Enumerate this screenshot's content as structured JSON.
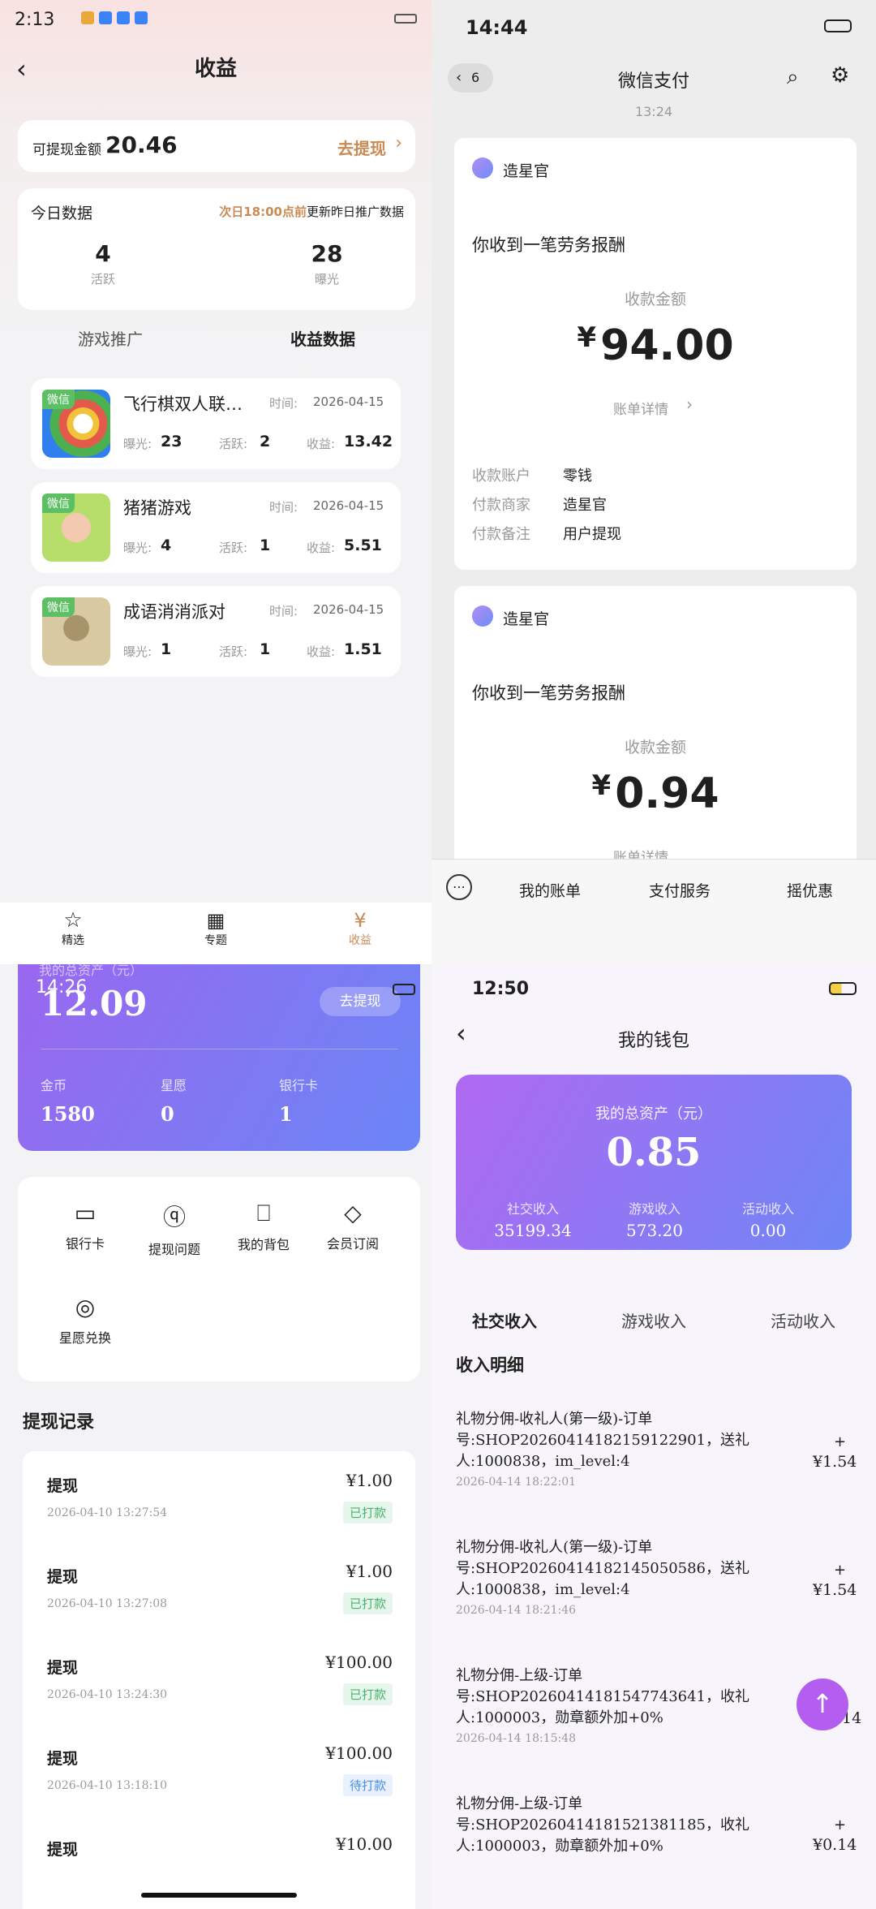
{
  "q1": {
    "status_time": "2:13",
    "title": "收益",
    "balance_label": "可提现金额",
    "balance_value": "20.46",
    "withdraw_link": "去提现",
    "today_title": "今日数据",
    "today_note_highlight": "次日18:00点前",
    "today_note_rest": "更新昨日推广数据",
    "stat_active_value": "4",
    "stat_active_label": "活跃",
    "stat_exposure_value": "28",
    "stat_exposure_label": "曝光",
    "tab_promo": "游戏推广",
    "tab_income": "收益数据",
    "games": [
      {
        "tag": "微信",
        "name": "飞行棋双人联…",
        "time_label": "时间:",
        "time": "2026-04-15",
        "exp_label": "曝光:",
        "exp": "23",
        "act_label": "活跃:",
        "act": "2",
        "inc_label": "收益:",
        "inc": "13.42"
      },
      {
        "tag": "微信",
        "name": "猪猪游戏",
        "time_label": "时间:",
        "time": "2026-04-15",
        "exp_label": "曝光:",
        "exp": "4",
        "act_label": "活跃:",
        "act": "1",
        "inc_label": "收益:",
        "inc": "5.51"
      },
      {
        "tag": "微信",
        "name": "成语消消派对",
        "time_label": "时间:",
        "time": "2026-04-15",
        "exp_label": "曝光:",
        "exp": "1",
        "act_label": "活跃:",
        "act": "1",
        "inc_label": "收益:",
        "inc": "1.51"
      }
    ],
    "nav": [
      {
        "label": "精选"
      },
      {
        "label": "专题"
      },
      {
        "label": "收益"
      }
    ],
    "accent": "#c98a55"
  },
  "q2": {
    "status_time": "14:44",
    "back_count": "6",
    "title": "微信支付",
    "timestamp": "13:24",
    "msgs": [
      {
        "sender": "造星官",
        "headline": "你收到一笔劳务报酬",
        "amount_label": "收款金额",
        "currency": "¥",
        "amount": "94.00",
        "detail": "账单详情",
        "rows": [
          {
            "k": "收款账户",
            "v": "零钱"
          },
          {
            "k": "付款商家",
            "v": "造星官"
          },
          {
            "k": "付款备注",
            "v": "用户提现"
          }
        ]
      },
      {
        "sender": "造星官",
        "headline": "你收到一笔劳务报酬",
        "amount_label": "收款金额",
        "currency": "¥",
        "amount": "0.94",
        "detail": "账单详情",
        "rows": []
      }
    ],
    "menu": [
      "我的账单",
      "支付服务",
      "摇优惠"
    ]
  },
  "q3": {
    "status_time": "14:26",
    "overlay_label": "我的总资产（元）",
    "total": "12.09",
    "withdraw_btn": "去提现",
    "assets": [
      {
        "label": "金币",
        "value": "1580"
      },
      {
        "label": "星愿",
        "value": "0"
      },
      {
        "label": "银行卡",
        "value": "1"
      }
    ],
    "actions": [
      "银行卡",
      "提现问题",
      "我的背包",
      "会员订阅",
      "星愿兑换"
    ],
    "records_title": "提现记录",
    "records": [
      {
        "title": "提现",
        "amount": "¥1.00",
        "time": "2026-04-10 13:27:54",
        "status": "已打款"
      },
      {
        "title": "提现",
        "amount": "¥1.00",
        "time": "2026-04-10 13:27:08",
        "status": "已打款"
      },
      {
        "title": "提现",
        "amount": "¥100.00",
        "time": "2026-04-10 13:24:30",
        "status": "已打款"
      },
      {
        "title": "提现",
        "amount": "¥100.00",
        "time": "2026-04-10 13:18:10",
        "status": "待打款"
      },
      {
        "title": "提现",
        "amount": "¥10.00",
        "time": "",
        "status": ""
      }
    ]
  },
  "q4": {
    "status_time": "12:50",
    "title": "我的钱包",
    "total_label": "我的总资产（元）",
    "total": "0.85",
    "sub": [
      {
        "label": "社交收入",
        "value": "35199.34"
      },
      {
        "label": "游戏收入",
        "value": "573.20"
      },
      {
        "label": "活动收入",
        "value": "0.00"
      }
    ],
    "tabs": [
      "社交收入",
      "游戏收入",
      "活动收入"
    ],
    "detail_title": "收入明细",
    "items": [
      {
        "text": "礼物分佣-收礼人(第一级)-订单号:SHOP20260414182159122901，送礼人:1000838，im_level:4",
        "time": "2026-04-14 18:22:01",
        "sign": "+",
        "amount": "¥1.54"
      },
      {
        "text": "礼物分佣-收礼人(第一级)-订单号:SHOP20260414182145050586，送礼人:1000838，im_level:4",
        "time": "2026-04-14 18:21:46",
        "sign": "+",
        "amount": "¥1.54"
      },
      {
        "text": "礼物分佣-上级-订单号:SHOP20260414181547743641，收礼人:1000003，勋章额外加+0%",
        "time": "2026-04-14 18:15:48",
        "sign": "",
        "amount": "14"
      },
      {
        "text": "礼物分佣-上级-订单号:SHOP20260414181521381185，收礼人:1000003，勋章额外加+0%",
        "time": "",
        "sign": "+",
        "amount": "¥0.14"
      }
    ]
  }
}
